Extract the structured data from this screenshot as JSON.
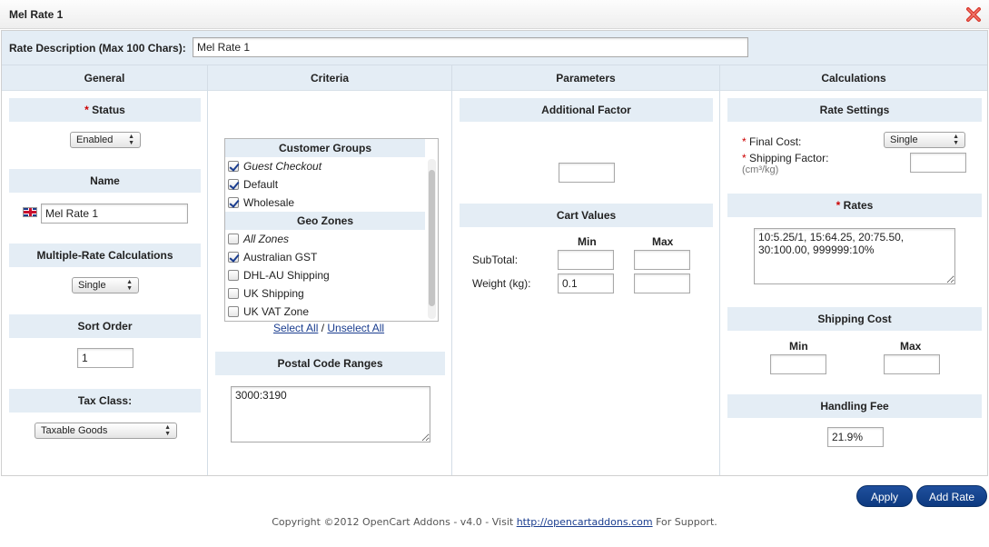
{
  "window": {
    "title": "Mel Rate 1"
  },
  "description": {
    "label": "Rate Description (Max 100 Chars):",
    "value": "Mel Rate 1"
  },
  "columns": {
    "general": "General",
    "criteria": "Criteria",
    "parameters": "Parameters",
    "calculations": "Calculations"
  },
  "general": {
    "status": {
      "label": "Status",
      "value": "Enabled"
    },
    "name": {
      "label": "Name",
      "value": "Mel Rate 1"
    },
    "multirate": {
      "label": "Multiple-Rate Calculations",
      "value": "Single"
    },
    "sort_order": {
      "label": "Sort Order",
      "value": "1"
    },
    "tax_class": {
      "label": "Tax Class:",
      "value": "Taxable Goods"
    }
  },
  "criteria": {
    "customer_groups_head": "Customer Groups",
    "customer_groups": [
      {
        "label": "Guest Checkout",
        "checked": true,
        "italic": true
      },
      {
        "label": "Default",
        "checked": true,
        "italic": false
      },
      {
        "label": "Wholesale",
        "checked": true,
        "italic": false
      }
    ],
    "geo_zones_head": "Geo Zones",
    "geo_zones": [
      {
        "label": "All Zones",
        "checked": false,
        "italic": true
      },
      {
        "label": "Australian GST",
        "checked": true,
        "italic": false
      },
      {
        "label": "DHL-AU Shipping",
        "checked": false,
        "italic": false
      },
      {
        "label": "UK Shipping",
        "checked": false,
        "italic": false
      },
      {
        "label": "UK VAT Zone",
        "checked": false,
        "italic": false
      }
    ],
    "select_all": "Select All",
    "separator": "/",
    "unselect_all": "Unselect All",
    "postal_head": "Postal Code Ranges",
    "postal_value": "3000:3190"
  },
  "parameters": {
    "additional_factor_head": "Additional Factor",
    "additional_factor_value": "",
    "cart_values_head": "Cart Values",
    "min_label": "Min",
    "max_label": "Max",
    "subtotal_label": "SubTotal:",
    "subtotal_min": "",
    "subtotal_max": "",
    "weight_label": "Weight (kg):",
    "weight_min": "0.1",
    "weight_max": ""
  },
  "calculations": {
    "rate_settings_head": "Rate Settings",
    "final_cost_label": "Final Cost:",
    "final_cost_value": "Single",
    "shipping_factor_label": "Shipping Factor:",
    "shipping_factor_unit": "(cm³/kg)",
    "shipping_factor_value": "",
    "rates_head": "Rates",
    "rates_value": "10:5.25/1, 15:64.25, 20:75.50, 30:100.00, 999999:10%",
    "shipping_cost_head": "Shipping Cost",
    "min_label": "Min",
    "max_label": "Max",
    "shipping_cost_min": "",
    "shipping_cost_max": "",
    "handling_fee_head": "Handling Fee",
    "handling_fee_value": "21.9%"
  },
  "buttons": {
    "apply": "Apply",
    "add_rate": "Add Rate"
  },
  "footer": {
    "prefix": "Copyright ©2012 OpenCart Addons - v4.0 - Visit",
    "link": "http://opencartaddons.com",
    "suffix": "For Support."
  },
  "icons": {
    "close": "close-icon",
    "flag": "uk-flag-icon",
    "select_arrow": "select-arrows-icon"
  },
  "colors": {
    "section_bg": "#e4edf5",
    "button": "#0d3a80",
    "close": "#d9362b",
    "required": "#cc0000"
  }
}
